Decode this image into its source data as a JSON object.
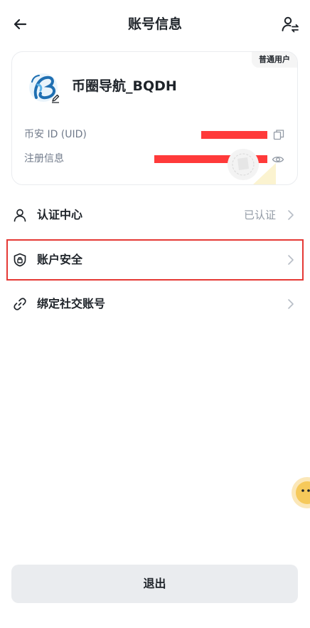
{
  "header": {
    "title": "账号信息"
  },
  "profile": {
    "badge": "普通用户",
    "nickname": "币圈导航_BQDH",
    "uid_label": "币安 ID (UID)",
    "register_label": "注册信息"
  },
  "menu": [
    {
      "label": "认证中心",
      "value": "已认证"
    },
    {
      "label": "账户安全",
      "value": ""
    },
    {
      "label": "绑定社交账号",
      "value": ""
    }
  ],
  "logout": {
    "label": "退出"
  },
  "colors": {
    "accent": "#F0B90B",
    "text": "#1E2329",
    "muted": "#707A8A",
    "redact": "#FF3A3A",
    "highlight": "#E53935"
  }
}
